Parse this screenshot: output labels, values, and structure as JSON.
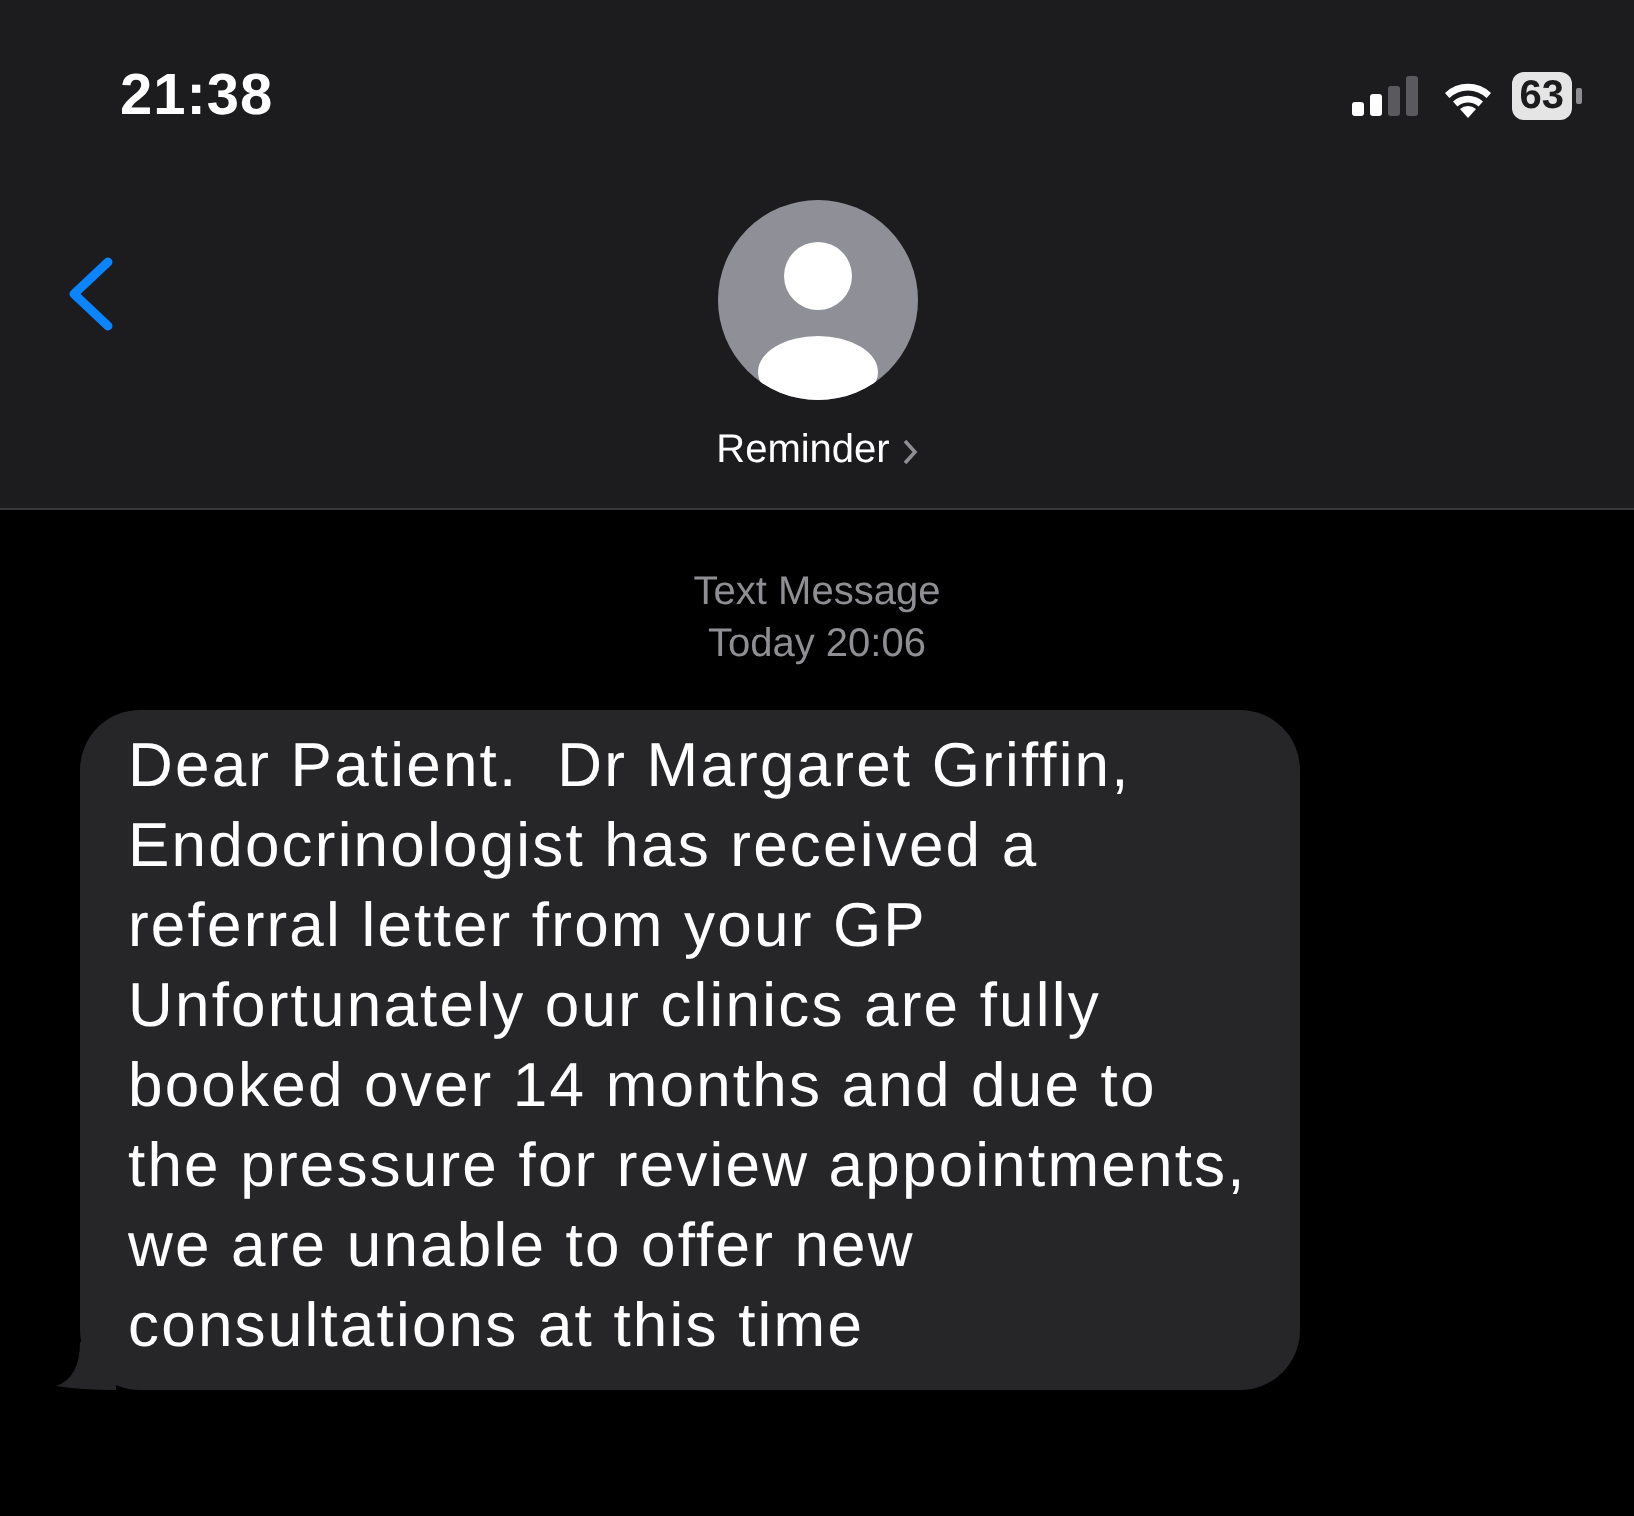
{
  "status_bar": {
    "time": "21:38",
    "battery": "63"
  },
  "header": {
    "contact": "Reminder"
  },
  "timestamp": {
    "service": "Text Message",
    "time": "Today 20:06"
  },
  "messages": [
    {
      "kind": "incoming",
      "text": "Dear Patient.  Dr Margaret Griffin, Endocrinologist has received a referral letter from your GP\nUnfortunately our clinics are fully booked over 14 months and due to the pressure for review appointments, we are unable to offer new consultations at this time"
    }
  ]
}
